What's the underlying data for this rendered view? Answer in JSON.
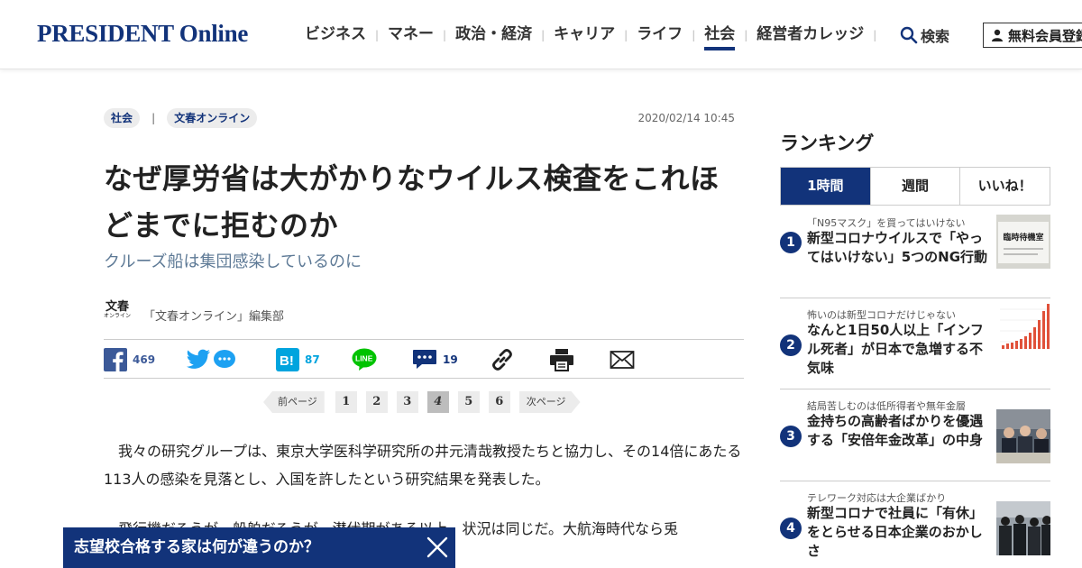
{
  "header": {
    "logo": "PRESIDENT Online",
    "nav": [
      {
        "label": "ビジネス",
        "active": false
      },
      {
        "label": "マネー",
        "active": false
      },
      {
        "label": "政治・経済",
        "active": false
      },
      {
        "label": "キャリア",
        "active": false
      },
      {
        "label": "ライフ",
        "active": false
      },
      {
        "label": "社会",
        "active": true
      },
      {
        "label": "経営者カレッジ",
        "active": false
      }
    ],
    "search_label": "検索",
    "member_label": "無料会員登録"
  },
  "article": {
    "category": "社会",
    "source": "文春オンライン",
    "date": "2020/02/14 10:45",
    "title": "なぜ厚労省は大がかりなウイルス検査をこれほどまでに拒むのか",
    "subtitle": "クルーズ船は集団感染しているのに",
    "author_logo_main": "文春",
    "author_logo_sub": "オンライン",
    "author": "「文春オンライン」編集部",
    "share": {
      "facebook_count": "469",
      "hatena_count": "87",
      "comment_count": "19"
    },
    "pager": {
      "prev": "前ページ",
      "next": "次ページ",
      "pages": [
        "1",
        "2",
        "3",
        "4",
        "5",
        "6"
      ],
      "current": "4"
    },
    "paragraphs": [
      "我々の研究グループは、東京大学医科学研究所の井元清哉教授たちと協力し、その14倍にあたる113人の感染を見落とし、入国を許したという研究結果を発表した。",
      "飛行機だろうが、船舶だろうが、潜伏期がある以上、状況は同じだ。大航海時代なら兎"
    ]
  },
  "banner": {
    "text": "志望校合格する家は何が違うのか？"
  },
  "sidebar": {
    "title": "ランキング",
    "tabs": [
      {
        "label": "1時間",
        "active": true
      },
      {
        "label": "週間",
        "active": false
      },
      {
        "label": "いいね！",
        "active": false
      }
    ],
    "items": [
      {
        "rank": "1",
        "kicker": "「N95マスク」を買ってはいけない",
        "headline": "新型コロナウイルスで「やってはいけない」5つのNG行動",
        "thumb_text": "臨時待機室"
      },
      {
        "rank": "2",
        "kicker": "怖いのは新型コロナだけじゃない",
        "headline": "なんと1日50人以上「インフル死者」が日本で急増する不気味",
        "thumb_text": ""
      },
      {
        "rank": "3",
        "kicker": "結局苦しむのは低所得者や無年金層",
        "headline": "金持ちの高齢者ばかりを優遇する「安倍年金改革」の中身",
        "thumb_text": ""
      },
      {
        "rank": "4",
        "kicker": "テレワーク対応は大企業ばかり",
        "headline": "新型コロナで社員に「有休」をとらせる日本企業のおかしさ",
        "thumb_text": ""
      }
    ]
  },
  "colors": {
    "brand_navy": "#12337a",
    "facebook": "#3b5998",
    "twitter": "#1da1f2",
    "hatena": "#00a4de",
    "line": "#00c300",
    "comment": "#12337a"
  }
}
